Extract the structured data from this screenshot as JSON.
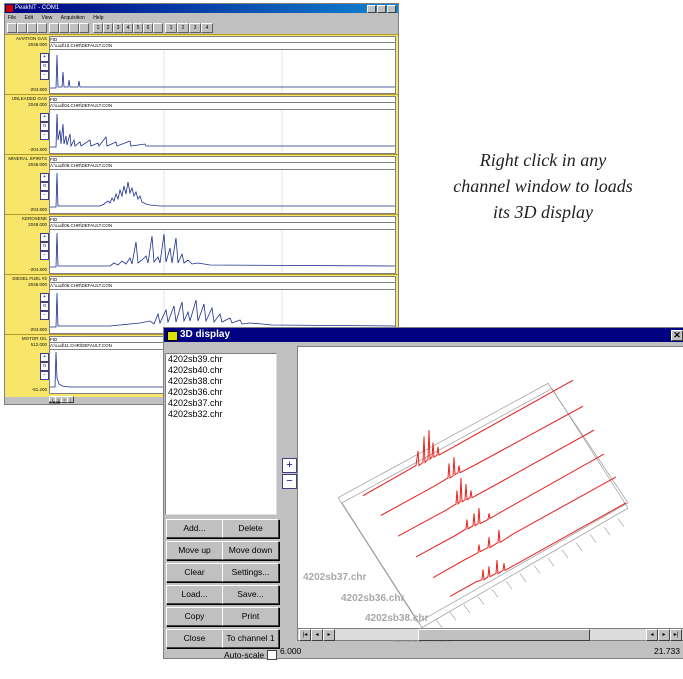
{
  "peaknt": {
    "title": "PeakNT - COM1",
    "menu": [
      "File",
      "Edit",
      "View",
      "Acquisition",
      "Help"
    ],
    "toolbar_numbers": [
      "1",
      "2",
      "3",
      "4",
      "5",
      "6"
    ],
    "toolbar_groups": [
      "1",
      "2",
      "3",
      "4"
    ],
    "channels": [
      {
        "name": "AVIATION GAS",
        "detector": "FID",
        "file": "A:\\Lud\\10.CHR\\DEFAULT.CON",
        "ymax": "2048.000",
        "ymin": "-204.800"
      },
      {
        "name": "UNLEADED GAS",
        "detector": "FID",
        "file": "A:\\Lud\\04.CHR\\DEFAULT.CON",
        "ymax": "2048.000",
        "ymin": "-204.800"
      },
      {
        "name": "MINERAL SPIRITS",
        "detector": "FID",
        "file": "A:\\Lud\\09.CHR\\DEFAULT.CON",
        "ymax": "2048.000",
        "ymin": "-204.800"
      },
      {
        "name": "KEROSENE",
        "detector": "FID",
        "file": "A:\\Lud\\06.CHR\\DEFAULT.CON",
        "ymax": "2048.000",
        "ymin": "-204.800"
      },
      {
        "name": "DIESEL FUEL #2",
        "detector": "FID",
        "file": "A:\\Lud\\05.CHR\\DEFAULT.CON",
        "ymax": "2048.000",
        "ymin": "-204.800"
      },
      {
        "name": "MOTOR OIL",
        "detector": "FID",
        "file": "A:\\Lud\\11.CHR\\DEFAULT.CON",
        "ymax": "512.000",
        "ymin": "-51.200"
      }
    ],
    "x_min": "0.000"
  },
  "caption": {
    "line1": "Right click in any",
    "line2": "channel window to loads",
    "line3": "its 3D display"
  },
  "display3d": {
    "title": "3D display",
    "files": [
      "4202sb39.chr",
      "4202sb40.chr",
      "4202sb38.chr",
      "4202sb36.chr",
      "4202sb37.chr",
      "4202sb32.chr"
    ],
    "buttons": {
      "add": "Add...",
      "delete": "Delete",
      "move_up": "Move up",
      "move_down": "Move down",
      "clear": "Clear",
      "settings": "Settings...",
      "load": "Load...",
      "save": "Save...",
      "copy": "Copy",
      "print": "Print",
      "close": "Close",
      "to_channel": "To channel 1"
    },
    "autoscale_label": "Auto-scale",
    "trace_labels": [
      "4202sb37.chr",
      "4202sb36.chr",
      "4202sb38.chr",
      "4202sb40.chr"
    ],
    "x_min": "6.000",
    "x_max": "21.733",
    "trace_color": "#e8231e"
  }
}
